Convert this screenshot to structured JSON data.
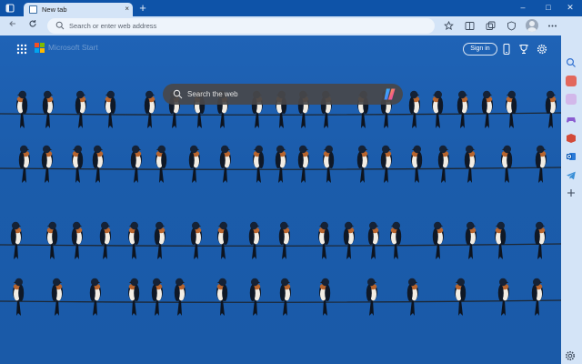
{
  "browser": {
    "tab": {
      "title": "New tab",
      "close_glyph": "×"
    },
    "new_tab_glyph": "+",
    "window_controls": {
      "minimize": "–",
      "maximize": "□",
      "close": "✕"
    },
    "address_bar": {
      "placeholder": "Search or enter web address"
    }
  },
  "page": {
    "brand": "Microsoft Start",
    "sign_in_label": "Sign in",
    "search_placeholder": "Search the web"
  },
  "colors": {
    "chrome": "#d4e4f7",
    "titlebar": "#0e53a8",
    "sky": "#1c5fb0",
    "search_box": "#48484a"
  },
  "icons": {
    "toolbar": [
      "back-icon",
      "refresh-icon",
      "favorites-star-icon",
      "split-screen-icon",
      "collections-icon",
      "browser-essentials-icon",
      "profile-avatar",
      "more-icon"
    ],
    "sidebar": [
      "search-icon",
      "shopping-icon",
      "tools-icon",
      "games-icon",
      "office-icon",
      "outlook-icon",
      "telegram-icon",
      "add-icon",
      "settings-icon"
    ]
  }
}
